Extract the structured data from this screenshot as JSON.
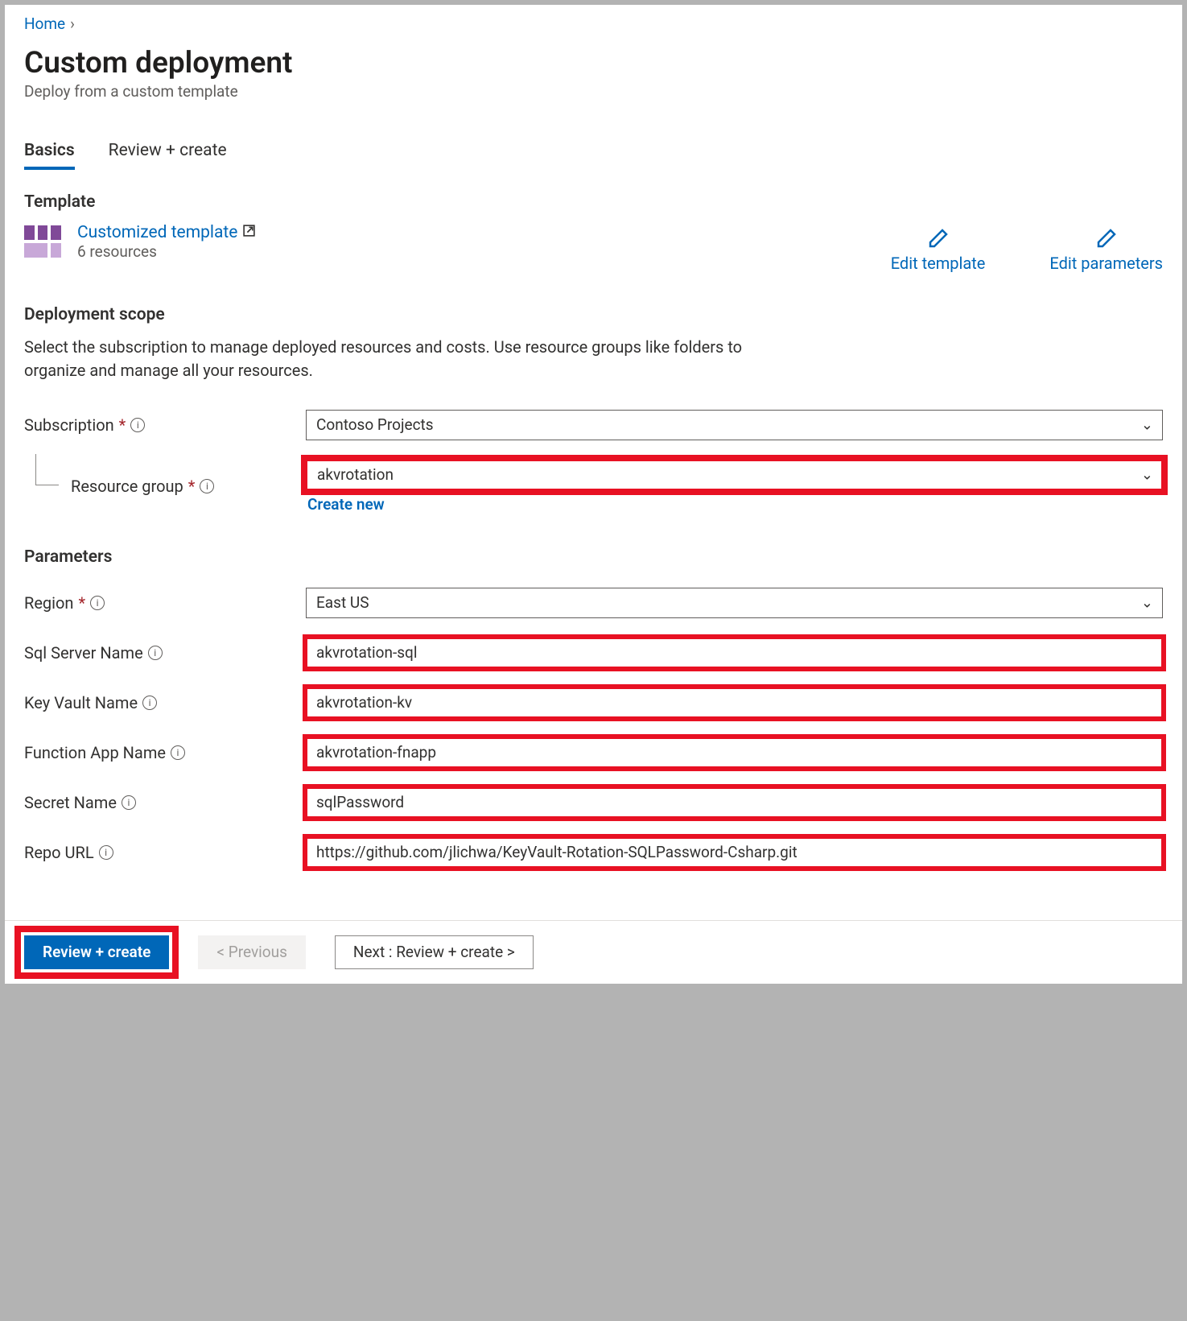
{
  "breadcrumb": {
    "home": "Home"
  },
  "page": {
    "title": "Custom deployment",
    "subtitle": "Deploy from a custom template"
  },
  "tabs": {
    "basics": "Basics",
    "review": "Review + create"
  },
  "template": {
    "section": "Template",
    "link": "Customized template",
    "resources": "6 resources",
    "edit_template": "Edit template",
    "edit_parameters": "Edit parameters"
  },
  "scope": {
    "section": "Deployment scope",
    "description": "Select the subscription to manage deployed resources and costs. Use resource groups like folders to organize and manage all your resources.",
    "subscription_label": "Subscription",
    "subscription_value": "Contoso Projects",
    "resource_group_label": "Resource group",
    "resource_group_value": "akvrotation",
    "create_new": "Create new"
  },
  "params": {
    "section": "Parameters",
    "region_label": "Region",
    "region_value": "East US",
    "sql_label": "Sql Server Name",
    "sql_value": "akvrotation-sql",
    "kv_label": "Key Vault Name",
    "kv_value": "akvrotation-kv",
    "fn_label": "Function App Name",
    "fn_value": "akvrotation-fnapp",
    "secret_label": "Secret Name",
    "secret_value": "sqlPassword",
    "repo_label": "Repo URL",
    "repo_value": "https://github.com/jlichwa/KeyVault-Rotation-SQLPassword-Csharp.git"
  },
  "footer": {
    "review": "Review + create",
    "previous": "< Previous",
    "next": "Next : Review + create >"
  }
}
